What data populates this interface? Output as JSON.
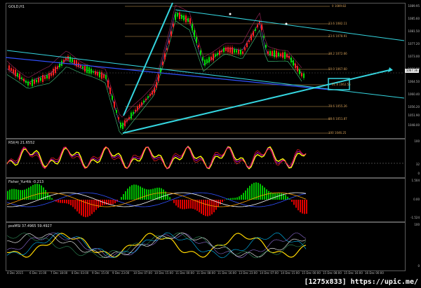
{
  "chart": {
    "symbol_label": "GOLD,H1",
    "rsi_label": "RSI(4) 21.6552",
    "fisher_label": "Fisher_Yur4ik -0.213",
    "psych_label": "pssMSI 37.4965 59.4927",
    "current_price": "1067.36",
    "watermark": "[1275x833] https://upic.me/"
  },
  "price_axis": [
    "1089.95",
    "1085.60",
    "1081.50",
    "1077.20",
    "1073.00",
    "1068.80",
    "1064.50",
    "1060.40",
    "1056.20",
    "1051.90",
    "1048.00"
  ],
  "fib_levels": [
    "0 1089.82",
    "23.6 1082.11",
    "23.6 1078.91",
    "38.2 1072.66",
    "50.0 1067.60",
    "61.8 1062.55",
    "78.6 1055.26",
    "88.6 1051.87",
    "100 1046.25"
  ],
  "rsi_axis": [
    "100",
    "32",
    "0"
  ],
  "fisher_axis": [
    "1.504",
    "0.00",
    "-1.524"
  ],
  "psych_axis": [
    "100",
    "0"
  ],
  "time_axis": [
    "4 Dec 2015",
    "6 Dec 11:00",
    "7 Dec 18:00",
    "8 Dec 03:00",
    "9 Dec 15:00",
    "9 Dec 23:00",
    "10 Dec 07:00",
    "10 Dec 15:00",
    "11 Dec 00:00",
    "11 Dec 08:00",
    "11 Dec 16:00",
    "13 Dec 23:00",
    "14 Dec 07:00",
    "14 Dec 15:00",
    "15 Dec 00:00",
    "15 Dec 08:00",
    "15 Dec 16:00",
    "16 Dec 00:00"
  ],
  "colors": {
    "bg": "#000000",
    "bull": "#00e000",
    "bear": "#ff2020",
    "trend": "#35d6e0",
    "fib": "#d9a35a",
    "rsi": "#ffff00",
    "fisher_pos": "#00c000",
    "fisher_neg": "#e00000"
  }
}
